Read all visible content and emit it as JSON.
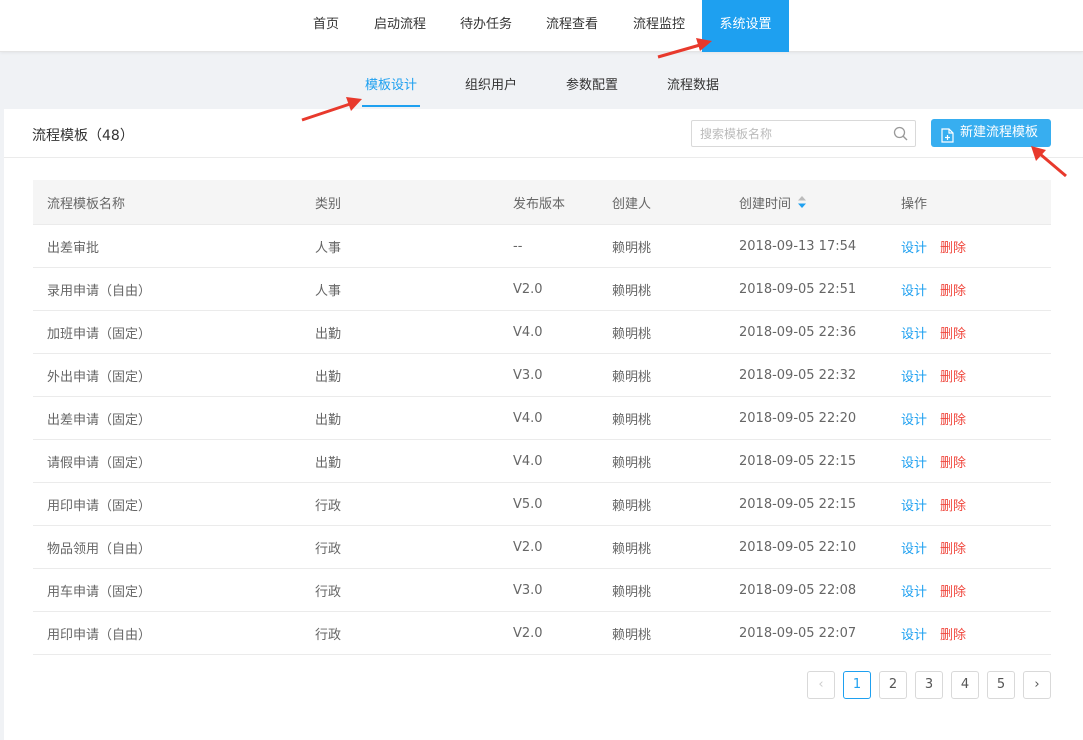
{
  "topnav": {
    "items": [
      {
        "label": "首页"
      },
      {
        "label": "启动流程"
      },
      {
        "label": "待办任务"
      },
      {
        "label": "流程查看"
      },
      {
        "label": "流程监控"
      },
      {
        "label": "系统设置",
        "active": true
      }
    ]
  },
  "subnav": {
    "tabs": [
      {
        "label": "模板设计",
        "active": true
      },
      {
        "label": "组织用户"
      },
      {
        "label": "参数配置"
      },
      {
        "label": "流程数据"
      }
    ]
  },
  "panel": {
    "title": "流程模板（48）",
    "search_placeholder": "搜索模板名称",
    "search_value": "",
    "new_button_label": "新建流程模板"
  },
  "table": {
    "headers": [
      "流程模板名称",
      "类别",
      "发布版本",
      "创建人",
      "创建时间",
      "操作"
    ],
    "action_design": "设计",
    "action_delete": "删除",
    "rows": [
      {
        "name": "出差审批",
        "category": "人事",
        "version": "--",
        "creator": "赖明桃",
        "created": "2018-09-13 17:54"
      },
      {
        "name": "录用申请（自由）",
        "category": "人事",
        "version": "V2.0",
        "creator": "赖明桃",
        "created": "2018-09-05 22:51"
      },
      {
        "name": "加班申请（固定）",
        "category": "出勤",
        "version": "V4.0",
        "creator": "赖明桃",
        "created": "2018-09-05 22:36"
      },
      {
        "name": "外出申请（固定）",
        "category": "出勤",
        "version": "V3.0",
        "creator": "赖明桃",
        "created": "2018-09-05 22:32"
      },
      {
        "name": "出差申请（固定）",
        "category": "出勤",
        "version": "V4.0",
        "creator": "赖明桃",
        "created": "2018-09-05 22:20"
      },
      {
        "name": "请假申请（固定）",
        "category": "出勤",
        "version": "V4.0",
        "creator": "赖明桃",
        "created": "2018-09-05 22:15"
      },
      {
        "name": "用印申请（固定）",
        "category": "行政",
        "version": "V5.0",
        "creator": "赖明桃",
        "created": "2018-09-05 22:15"
      },
      {
        "name": "物品领用（自由）",
        "category": "行政",
        "version": "V2.0",
        "creator": "赖明桃",
        "created": "2018-09-05 22:10"
      },
      {
        "name": "用车申请（固定）",
        "category": "行政",
        "version": "V3.0",
        "creator": "赖明桃",
        "created": "2018-09-05 22:08"
      },
      {
        "name": "用印申请（自由）",
        "category": "行政",
        "version": "V2.0",
        "creator": "赖明桃",
        "created": "2018-09-05 22:07"
      }
    ]
  },
  "pagination": {
    "prev": "‹",
    "next": "›",
    "pages": [
      "1",
      "2",
      "3",
      "4",
      "5"
    ],
    "current": 1
  },
  "colors": {
    "accent": "#1ea0f0",
    "button": "#37aef0",
    "delete": "#f0463c",
    "annotation_arrow": "#e8392c"
  },
  "icons": {
    "search": "search-icon",
    "new_file": "file-plus-icon",
    "sort": "sort-icon"
  }
}
